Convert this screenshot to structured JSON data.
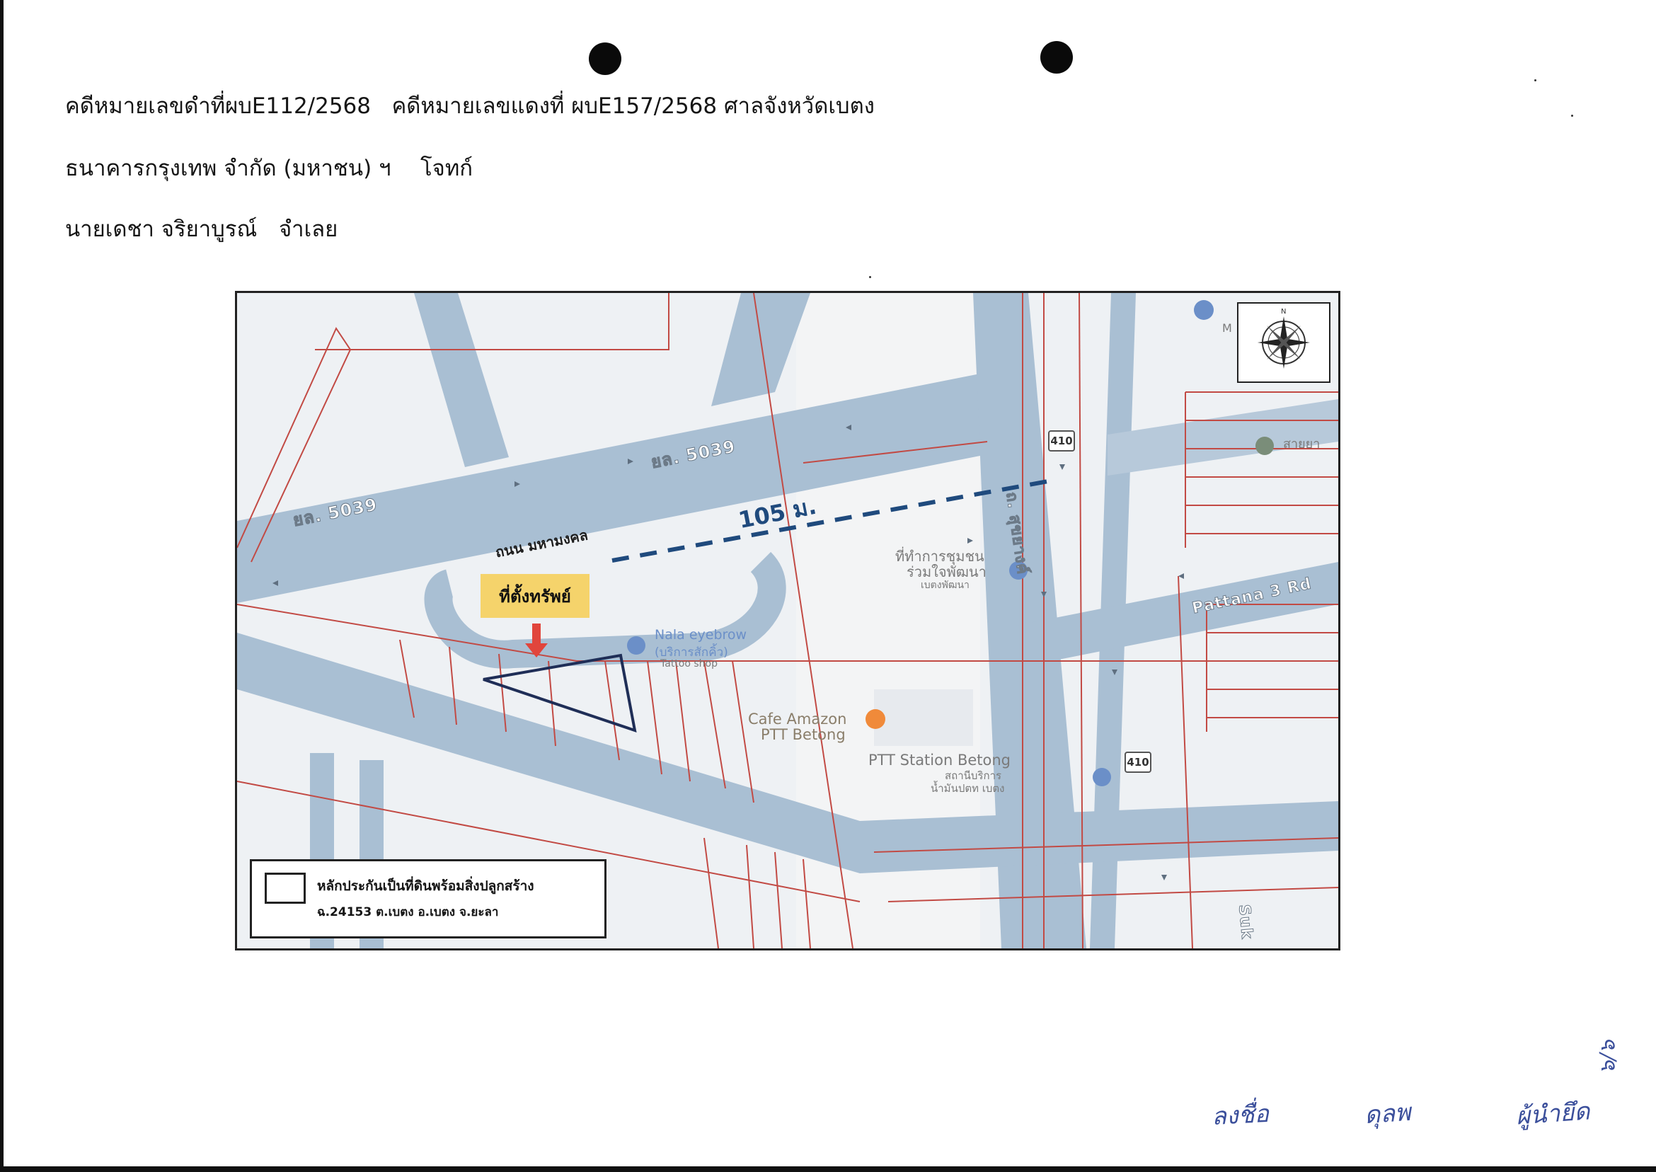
{
  "header": {
    "case_line": "คดีหมายเลขดำที่ผบE112/2568   คดีหมายเลขแดงที่ ผบE157/2568 ศาลจังหวัดเบตง",
    "plaintiff_name": "ธนาคารกรุงเทพ จำกัด (มหาชน) ฯ",
    "plaintiff_role": "โจทก์",
    "defendant_name": "นายเดชา จริยาบูรณ์",
    "defendant_role": "จำเลย"
  },
  "map": {
    "road_label_1": "ยล. 5039",
    "road_label_2": "ยล. 5039",
    "road_name": "ถนน มหามงคล",
    "distance": "105 ม.",
    "property_tag": "ที่ตั้งทรัพย์",
    "road_sukhyang": "ถ. สุขยางค์",
    "road_pattana": "Pattana 3 Rd",
    "road_suk": "Suk",
    "shield_1": "410",
    "shield_2": "410",
    "poi_1": "ที่ทำการชุมชน",
    "poi_1b": "ร่วมใจพัฒนา",
    "poi_1c": "เบตงพัฒนา",
    "poi_2": "Nala eyebrow",
    "poi_2b": "(บริการสักคิ้ว)",
    "poi_2c": "Tattoo shop",
    "poi_3": "Cafe Amazon",
    "poi_3b": "PTT Betong",
    "poi_4": "PTT Station Betong",
    "poi_4b": "สถานีบริการ",
    "poi_4c": "น้ำมันปตท เบตง",
    "poi_5": "M",
    "poi_6": "สายยา",
    "legend_line1": "หลักประกันเป็นที่ดินพร้อมสิ่งปลูกสร้าง",
    "legend_line2": "ฉ.24153 ต.เบตง อ.เบตง จ.ยะลา"
  },
  "signatures": {
    "s1": "ลงชื่อ",
    "s2": "ดุลพ",
    "s3": "ผู้นำยึด",
    "page_mark": "๖/๖"
  },
  "colors": {
    "road": "#a9bfd3",
    "parcel_line": "#c24a44",
    "outline": "#1f2e57",
    "tag": "#f5d36b",
    "arrow": "#e1453c",
    "signature_ink": "#3b4f9b"
  }
}
